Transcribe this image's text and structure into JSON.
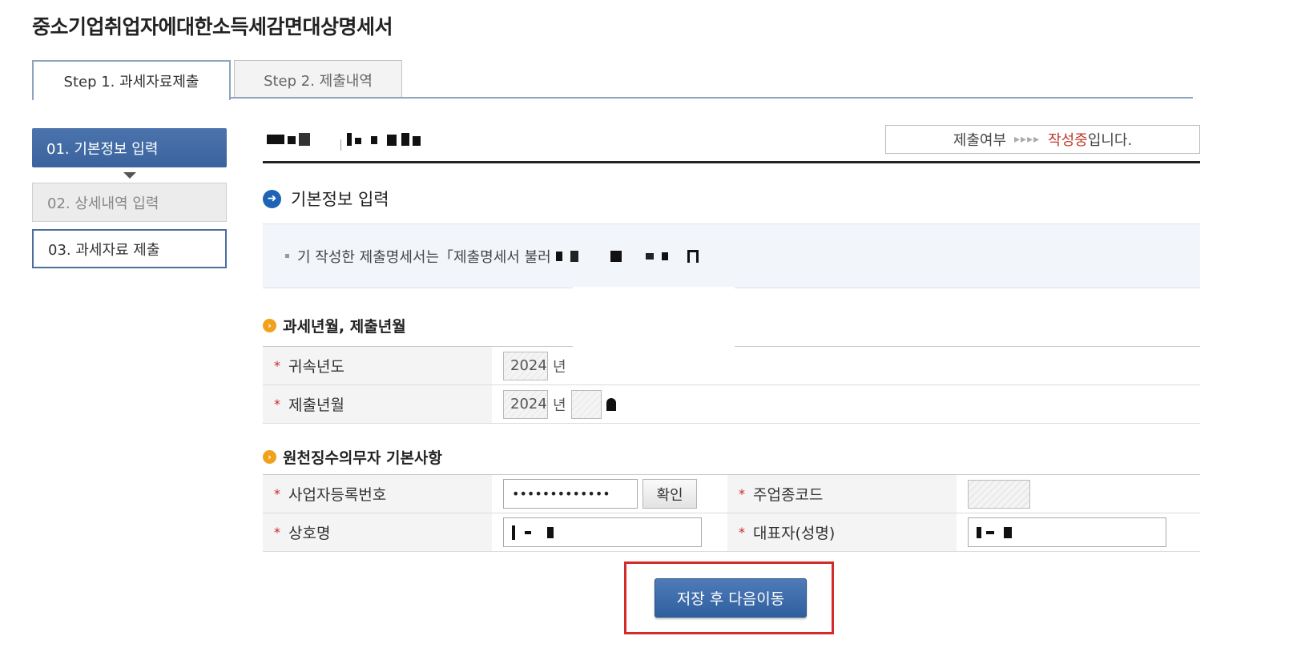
{
  "page_title": "중소기업취업자에대한소득세감면대상명세서",
  "tabs": [
    {
      "label": "Step 1. 과세자료제출",
      "active": true
    },
    {
      "label": "Step 2. 제출내역",
      "active": false
    }
  ],
  "steps": [
    {
      "label": "01. 기본정보 입력",
      "state": "active"
    },
    {
      "label": "02. 상세내역 입력",
      "state": "disabled"
    },
    {
      "label": "03. 과세자료 제출",
      "state": "normal"
    }
  ],
  "status": {
    "label": "제출여부",
    "arrows": "▸▸▸▸",
    "value": "작성중",
    "suffix": "입니다."
  },
  "section": {
    "title": "기본정보 입력",
    "icon": "arrow-right-circle-icon"
  },
  "notice": {
    "text": "기 작성한 제출명세서는「제출명세서 불러"
  },
  "tax_period": {
    "heading": "과세년월, 제출년월",
    "rows": [
      {
        "label": "귀속년도",
        "year": "2024",
        "year_unit": "년"
      },
      {
        "label": "제출년월",
        "year": "2024",
        "year_unit": "년"
      }
    ]
  },
  "withholder": {
    "heading": "원천징수의무자 기본사항",
    "business_no_label": "사업자등록번호",
    "business_no_value": "•••••••••••••",
    "confirm_button": "확인",
    "industry_code_label": "주업종코드",
    "company_name_label": "상호명",
    "representative_label": "대표자(성명)",
    "required_mark": "*"
  },
  "save_button": "저장 후 다음이동",
  "colors": {
    "primary_blue": "#3a639d",
    "status_red": "#c0392b",
    "highlight_red": "#d42a2a",
    "orange": "#f0a21c"
  }
}
